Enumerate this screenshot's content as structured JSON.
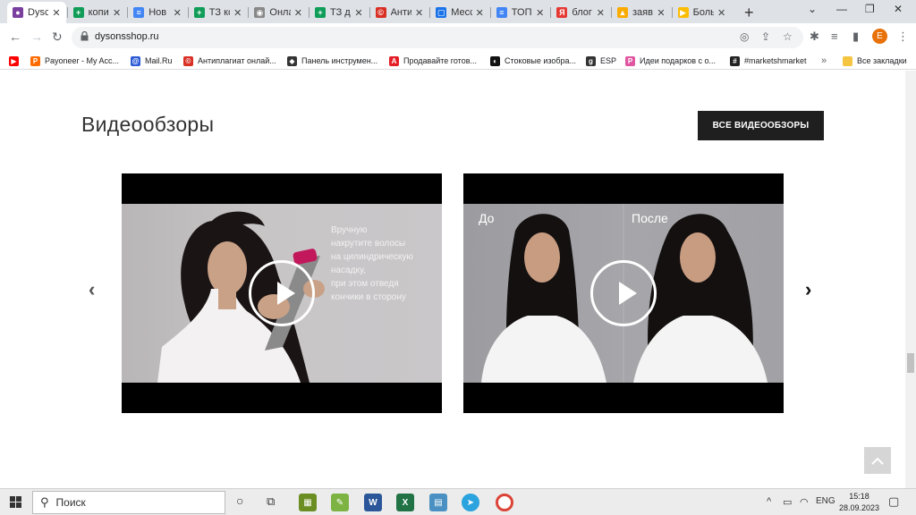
{
  "browser": {
    "tabs": [
      {
        "title": "Dysc",
        "fav_color": "#7b3fa0",
        "fav_char": "●"
      },
      {
        "title": "копи",
        "fav_color": "#0f9d58",
        "fav_char": "+"
      },
      {
        "title": "Нов",
        "fav_color": "#4285f4",
        "fav_char": "≡"
      },
      {
        "title": "ТЗ кс",
        "fav_color": "#0f9d58",
        "fav_char": "+"
      },
      {
        "title": "Онла",
        "fav_color": "#888888",
        "fav_char": "◉"
      },
      {
        "title": "ТЗ д",
        "fav_color": "#0f9d58",
        "fav_char": "+"
      },
      {
        "title": "Анти",
        "fav_color": "#d93025",
        "fav_char": "©"
      },
      {
        "title": "Месс",
        "fav_color": "#1a73e8",
        "fav_char": "▢"
      },
      {
        "title": "ТОП",
        "fav_color": "#4285f4",
        "fav_char": "≡"
      },
      {
        "title": "блог",
        "fav_color": "#e53935",
        "fav_char": "Я"
      },
      {
        "title": "заяв",
        "fav_color": "#f9ab00",
        "fav_char": "▲"
      },
      {
        "title": "Боль",
        "fav_color": "#fbbc04",
        "fav_char": "▶"
      }
    ],
    "url": "dysonsshop.ru",
    "profile_initial": "E",
    "bookmarks": [
      {
        "label": "",
        "color": "#ff0000",
        "char": "▶"
      },
      {
        "label": "Payoneer - My Acc...",
        "color": "#ff6b00",
        "char": "P"
      },
      {
        "label": "Mail.Ru",
        "color": "#2d5bd6",
        "char": "@"
      },
      {
        "label": "Антиплагиат онлай...",
        "color": "#d93025",
        "char": "©"
      },
      {
        "label": "Панель инструмен...",
        "color": "#333333",
        "char": "◆"
      },
      {
        "label": "Продавайте готов...",
        "color": "#e41e26",
        "char": "A"
      },
      {
        "label": "Стоковые изобра...",
        "color": "#111111",
        "char": "◐"
      },
      {
        "label": "ESP",
        "color": "#333333",
        "char": "g"
      },
      {
        "label": "Идеи подарков с о...",
        "color": "#e056a0",
        "char": "P"
      },
      {
        "label": "#marketshmarket",
        "color": "#222222",
        "char": "#"
      }
    ],
    "bookmarks_more": "»",
    "all_bookmarks": "Все закладки"
  },
  "page": {
    "section_title": "Видеообзоры",
    "all_button": "ВСЕ ВИДЕООБЗОРЫ",
    "video1_caption": "Вручную\nнакрутите волосы\nна цилиндрическую\nнасадку,\nпри этом отведя\nкончики в сторону",
    "video2_before": "До",
    "video2_after": "После"
  },
  "taskbar": {
    "search_placeholder": "Поиск",
    "language": "ENG",
    "time": "15:18",
    "date": "28.09.2023"
  }
}
